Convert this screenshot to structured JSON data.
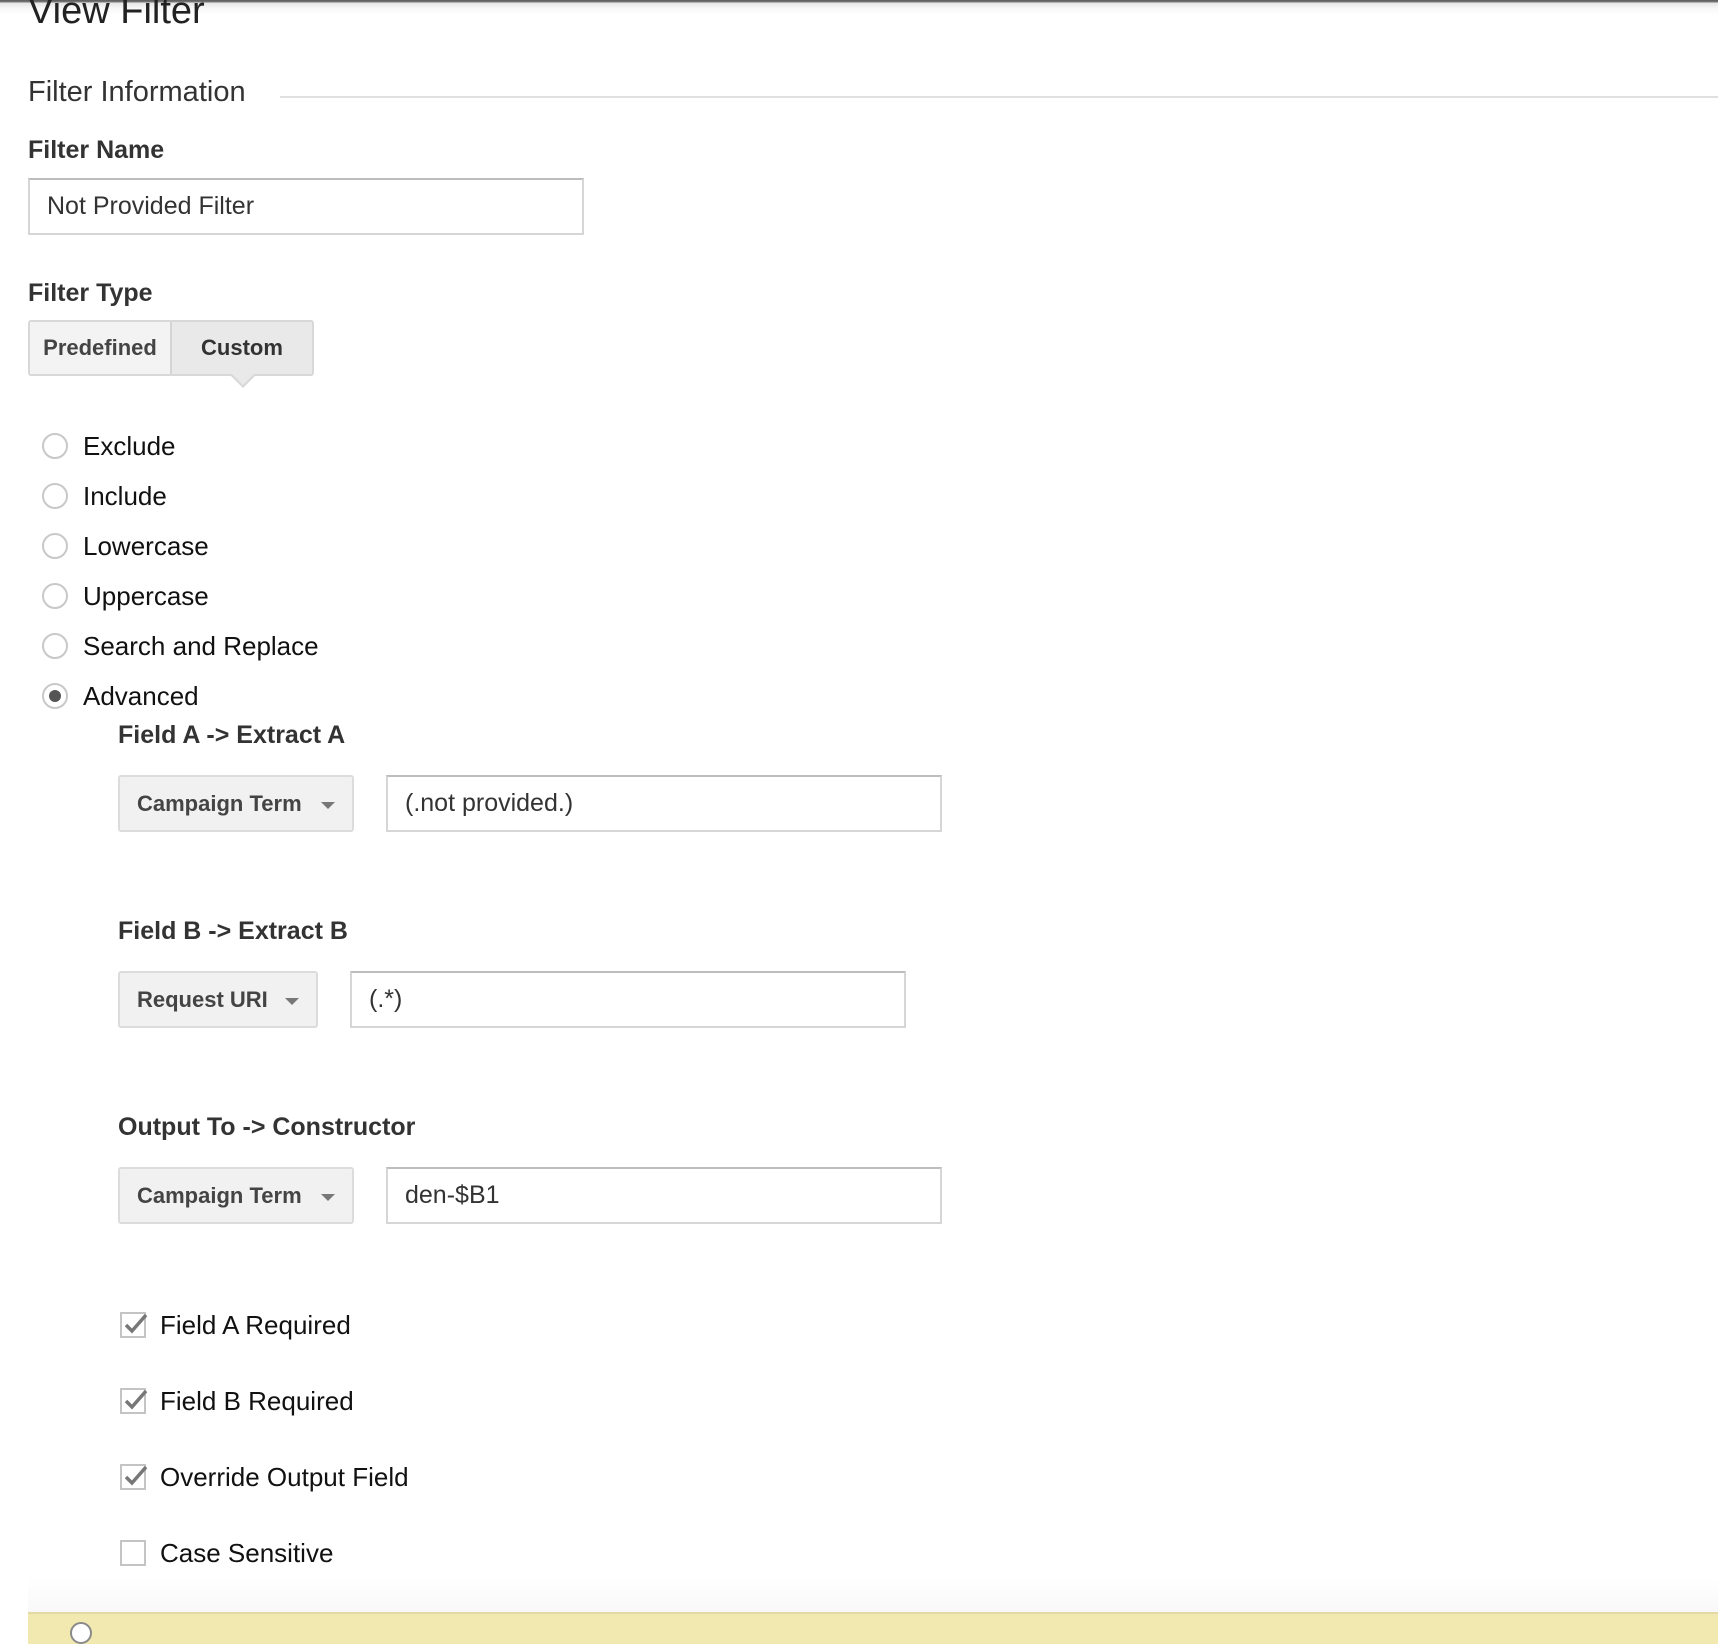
{
  "page": {
    "title": "View Filter"
  },
  "filter_information": {
    "section_title": "Filter Information",
    "filter_name": {
      "label": "Filter Name",
      "value": "Not Provided Filter"
    },
    "filter_type": {
      "label": "Filter Type",
      "tabs": [
        {
          "label": "Predefined",
          "selected": false
        },
        {
          "label": "Custom",
          "selected": true
        }
      ],
      "options": [
        {
          "label": "Exclude",
          "checked": false
        },
        {
          "label": "Include",
          "checked": false
        },
        {
          "label": "Lowercase",
          "checked": false
        },
        {
          "label": "Uppercase",
          "checked": false
        },
        {
          "label": "Search and Replace",
          "checked": false
        },
        {
          "label": "Advanced",
          "checked": true
        }
      ]
    },
    "advanced": {
      "field_a": {
        "label": "Field A -> Extract A",
        "field": "Campaign Term",
        "extract": "(.not provided.)"
      },
      "field_b": {
        "label": "Field B -> Extract B",
        "field": "Request URI",
        "extract": "(.*)"
      },
      "output": {
        "label": "Output To -> Constructor",
        "field": "Campaign Term",
        "constructor": "den-$B1"
      },
      "checkboxes": [
        {
          "label": "Field A Required",
          "checked": true
        },
        {
          "label": "Field B Required",
          "checked": true
        },
        {
          "label": "Override Output Field",
          "checked": true
        },
        {
          "label": "Case Sensitive",
          "checked": false
        }
      ]
    }
  },
  "icons": {
    "dropdown": "caret-down-icon",
    "check": "checkmark-icon",
    "help": "help-circle-icon"
  },
  "colors": {
    "help_bar_bg": "#f2e9b0",
    "radio_dot": "#555555"
  }
}
